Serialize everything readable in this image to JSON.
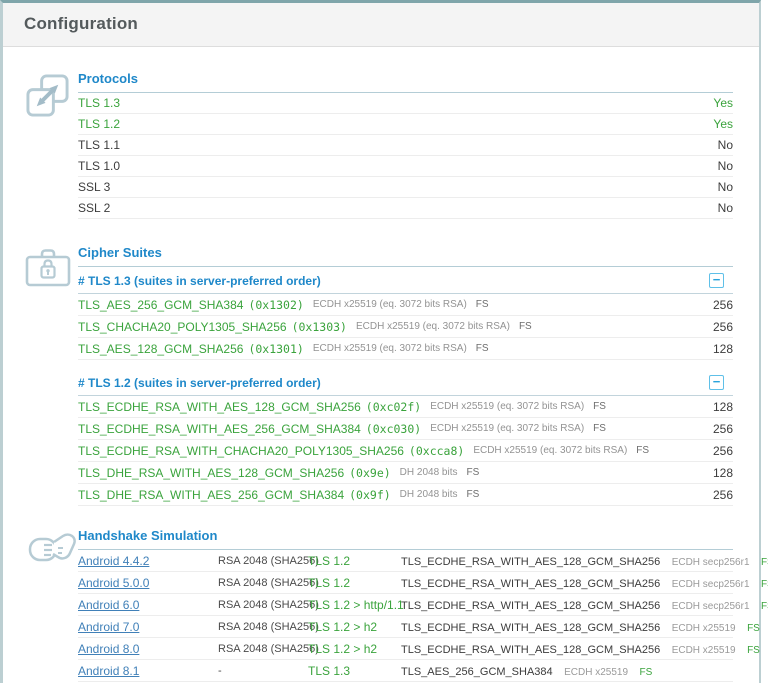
{
  "header": {
    "title": "Configuration"
  },
  "colors": {
    "accent_blue": "#1f88c9",
    "status_green": "#3aa33c",
    "link_blue": "#4080b8",
    "frame_teal": "#7fa5aa",
    "collapse_blue": "#2aa3dc"
  },
  "protocols": {
    "title": "Protocols",
    "icon": "expand-arrows-icon",
    "rows": [
      {
        "name": "TLS 1.3",
        "value": "Yes"
      },
      {
        "name": "TLS 1.2",
        "value": "Yes"
      },
      {
        "name": "TLS 1.1",
        "value": "No"
      },
      {
        "name": "TLS 1.0",
        "value": "No"
      },
      {
        "name": "SSL 3",
        "value": "No"
      },
      {
        "name": "SSL 2",
        "value": "No"
      }
    ]
  },
  "cipher_suites": {
    "title": "Cipher Suites",
    "icon": "briefcase-lock-icon",
    "collapse_label": "−",
    "groups": [
      {
        "header": "# TLS 1.3 (suites in server-preferred order)",
        "rows": [
          {
            "name": "TLS_AES_256_GCM_SHA384",
            "code": "(0x1302)",
            "kx": "ECDH x25519 (eq. 3072 bits RSA)",
            "fs": "FS",
            "bits": "256"
          },
          {
            "name": "TLS_CHACHA20_POLY1305_SHA256",
            "code": "(0x1303)",
            "kx": "ECDH x25519 (eq. 3072 bits RSA)",
            "fs": "FS",
            "bits": "256"
          },
          {
            "name": "TLS_AES_128_GCM_SHA256",
            "code": "(0x1301)",
            "kx": "ECDH x25519 (eq. 3072 bits RSA)",
            "fs": "FS",
            "bits": "128"
          }
        ]
      },
      {
        "header": "# TLS 1.2 (suites in server-preferred order)",
        "rows": [
          {
            "name": "TLS_ECDHE_RSA_WITH_AES_128_GCM_SHA256",
            "code": "(0xc02f)",
            "kx": "ECDH x25519 (eq. 3072 bits RSA)",
            "fs": "FS",
            "bits": "128"
          },
          {
            "name": "TLS_ECDHE_RSA_WITH_AES_256_GCM_SHA384",
            "code": "(0xc030)",
            "kx": "ECDH x25519 (eq. 3072 bits RSA)",
            "fs": "FS",
            "bits": "256"
          },
          {
            "name": "TLS_ECDHE_RSA_WITH_CHACHA20_POLY1305_SHA256",
            "code": "(0xcca8)",
            "kx": "ECDH x25519 (eq. 3072 bits RSA)",
            "fs": "FS",
            "bits": "256"
          },
          {
            "name": "TLS_DHE_RSA_WITH_AES_128_GCM_SHA256",
            "code": "(0x9e)",
            "kx": "DH 2048 bits",
            "fs": "FS",
            "bits": "128"
          },
          {
            "name": "TLS_DHE_RSA_WITH_AES_256_GCM_SHA384",
            "code": "(0x9f)",
            "kx": "DH 2048 bits",
            "fs": "FS",
            "bits": "256"
          }
        ]
      }
    ]
  },
  "handshake": {
    "title": "Handshake Simulation",
    "icon": "handshake-icon",
    "rows": [
      {
        "client": "Android 4.4.2",
        "key": "RSA 2048 (SHA256)",
        "protocol": "TLS 1.2",
        "cipher": "TLS_ECDHE_RSA_WITH_AES_128_GCM_SHA256",
        "kx": "ECDH secp256r1",
        "fs": "FS"
      },
      {
        "client": "Android 5.0.0",
        "key": "RSA 2048 (SHA256)",
        "protocol": "TLS 1.2",
        "cipher": "TLS_ECDHE_RSA_WITH_AES_128_GCM_SHA256",
        "kx": "ECDH secp256r1",
        "fs": "FS"
      },
      {
        "client": "Android 6.0",
        "key": "RSA 2048 (SHA256)",
        "protocol": "TLS 1.2 > http/1.1",
        "cipher": "TLS_ECDHE_RSA_WITH_AES_128_GCM_SHA256",
        "kx": "ECDH secp256r1",
        "fs": "FS"
      },
      {
        "client": "Android 7.0",
        "key": "RSA 2048 (SHA256)",
        "protocol": "TLS 1.2 > h2",
        "cipher": "TLS_ECDHE_RSA_WITH_AES_128_GCM_SHA256",
        "kx": "ECDH x25519",
        "fs": "FS"
      },
      {
        "client": "Android 8.0",
        "key": "RSA 2048 (SHA256)",
        "protocol": "TLS 1.2 > h2",
        "cipher": "TLS_ECDHE_RSA_WITH_AES_128_GCM_SHA256",
        "kx": "ECDH x25519",
        "fs": "FS"
      },
      {
        "client": "Android 8.1",
        "key": "-",
        "protocol": "TLS 1.3",
        "cipher": "TLS_AES_256_GCM_SHA384",
        "kx": "ECDH x25519",
        "fs": "FS"
      }
    ]
  }
}
